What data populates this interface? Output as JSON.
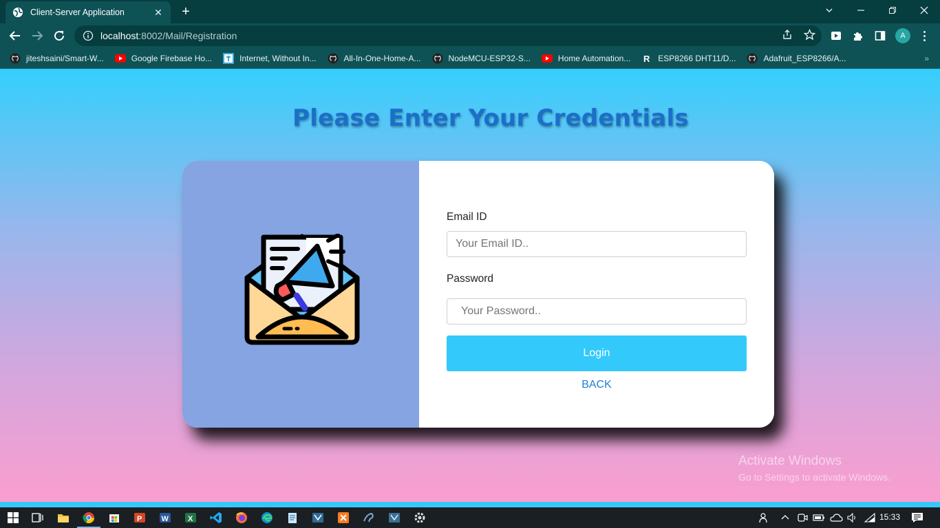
{
  "browser": {
    "tab_title": "Client-Server Application",
    "tab_close": "✕",
    "new_tab": "+",
    "url_host": "localhost",
    "url_path": ":8002/Mail/Registration",
    "profile_initial": "A",
    "bookmarks": [
      {
        "label": "jiteshsaini/Smart-W...",
        "icon": "github-icon"
      },
      {
        "label": "Google Firebase Ho...",
        "icon": "youtube-icon"
      },
      {
        "label": "Internet, Without In...",
        "icon": "tutorial-site-icon"
      },
      {
        "label": "All-In-One-Home-A...",
        "icon": "github-icon"
      },
      {
        "label": "NodeMCU-ESP32-S...",
        "icon": "github-icon"
      },
      {
        "label": "Home Automation...",
        "icon": "youtube-icon"
      },
      {
        "label": "ESP8266 DHT11/D...",
        "icon": "r-site-icon"
      },
      {
        "label": "Adafruit_ESP8266/A...",
        "icon": "github-icon"
      }
    ],
    "bookmarks_overflow": "»"
  },
  "page": {
    "heading": "Please Enter Your Credentials",
    "email_label": "Email ID",
    "email_placeholder": "Your Email ID..",
    "password_label": "Password",
    "password_placeholder": "Your Password..",
    "login_label": "Login",
    "back_label": "BACK",
    "watermark_line1": "Activate Windows",
    "watermark_line2": "Go to Settings to activate Windows."
  },
  "taskbar": {
    "time": "15:33",
    "apps": [
      "start-icon",
      "task-view-icon",
      "file-explorer-icon",
      "chrome-icon",
      "store-icon",
      "powerpoint-icon",
      "word-icon",
      "excel-icon",
      "vscode-icon",
      "firefox-icon",
      "edge-icon",
      "notepad-icon",
      "mysql-workbench-icon",
      "xampp-icon",
      "mysql-icon",
      "mysql-workbench-2-icon",
      "settings-icon"
    ]
  },
  "colors": {
    "accent": "#33c9fb",
    "heading": "#1c6fc9",
    "card_left": "#85a4e1",
    "link": "#1d7fd8"
  }
}
